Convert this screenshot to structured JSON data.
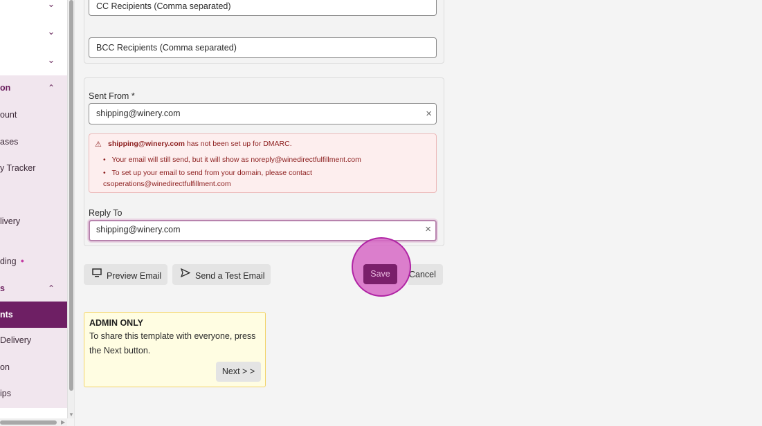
{
  "sidebar": {
    "items": [
      {
        "label": "on"
      },
      {
        "label": "ount"
      },
      {
        "label": "ases"
      },
      {
        "label": "y Tracker"
      },
      {
        "label": "livery"
      },
      {
        "label": "ding"
      },
      {
        "label": "s"
      },
      {
        "label": "nts"
      },
      {
        "label": "Delivery"
      },
      {
        "label": "on"
      },
      {
        "label": "ips"
      }
    ]
  },
  "form": {
    "cc_placeholder": "CC Recipients (Comma separated)",
    "bcc_placeholder": "BCC Recipients (Comma separated)",
    "sent_from_label": "Sent From *",
    "sent_from_value": "shipping@winery.com",
    "reply_to_label": "Reply To",
    "reply_to_value": "shipping@winery.com",
    "clear_glyph": "×"
  },
  "alert": {
    "email": "shipping@winery.com",
    "message": " has not been set up for DMARC.",
    "bullet1": "Your email will still send, but it will show as noreply@winedirectfulfillment.com",
    "bullet2": "To set up your email to send from your domain, please contact",
    "bullet2_cont": "csoperations@winedirectfulfillment.com"
  },
  "actions": {
    "preview_label": "Preview Email",
    "test_label": "Send a Test Email",
    "save_label": "Save",
    "cancel_label": "Cancel"
  },
  "admin": {
    "heading": "ADMIN ONLY",
    "line1": "To share this template with everyone, press",
    "line2": "the Next button.",
    "next_label": "Next > >"
  },
  "colors": {
    "brand": "#6e1f64",
    "highlight": "#d669c4",
    "alert_text": "#8c1e1e"
  }
}
